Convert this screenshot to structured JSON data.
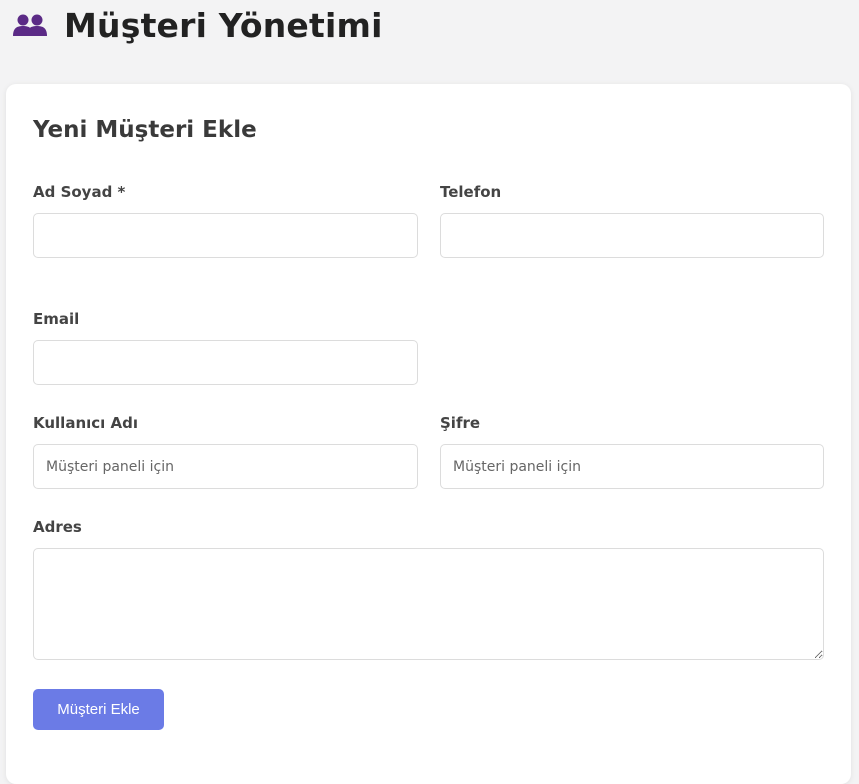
{
  "header": {
    "icon": "users-icon",
    "title": "Müşteri Yönetimi"
  },
  "form": {
    "title": "Yeni Müşteri Ekle",
    "fields": {
      "name": {
        "label": "Ad Soyad *",
        "value": "",
        "placeholder": ""
      },
      "phone": {
        "label": "Telefon",
        "value": "",
        "placeholder": ""
      },
      "email": {
        "label": "Email",
        "value": "",
        "placeholder": ""
      },
      "username": {
        "label": "Kullanıcı Adı",
        "value": "",
        "placeholder": "Müşteri paneli için"
      },
      "password": {
        "label": "Şifre",
        "value": "",
        "placeholder": "Müşteri paneli için"
      },
      "address": {
        "label": "Adres",
        "value": "",
        "placeholder": ""
      }
    },
    "submit_label": "Müşteri Ekle"
  },
  "colors": {
    "background": "#f3f3f4",
    "card": "#ffffff",
    "accent": "#6b7be6",
    "icon": "#5b2a86"
  }
}
